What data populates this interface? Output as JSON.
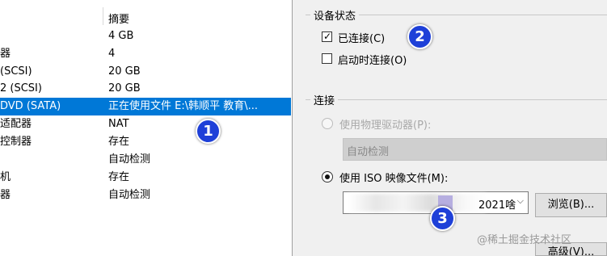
{
  "device_list": {
    "summary_header": "摘要",
    "rows": [
      {
        "device": "",
        "summary": "4 GB"
      },
      {
        "device": "器",
        "summary": "4"
      },
      {
        "device": " (SCSI)",
        "summary": "20 GB"
      },
      {
        "device": "2 (SCSI)",
        "summary": "20 GB"
      },
      {
        "device": "DVD (SATA)",
        "summary": "正在使用文件 E:\\韩顺平 教育\\..."
      },
      {
        "device": "适配器",
        "summary": "NAT"
      },
      {
        "device": "控制器",
        "summary": "存在"
      },
      {
        "device": "",
        "summary": "自动检测"
      },
      {
        "device": "机",
        "summary": "存在"
      },
      {
        "device": "器",
        "summary": "自动检测"
      }
    ],
    "selected_index": 4
  },
  "device_status": {
    "title": "设备状态",
    "connected_label": "已连接(C)",
    "connected_checked": true,
    "connect_at_power_on_label": "启动时连接(O)",
    "connect_at_power_on_checked": false
  },
  "connection": {
    "title": "连接",
    "physical_drive_label": "使用物理驱动器(P):",
    "physical_drive_value": "自动检测",
    "iso_label": "使用 ISO 映像文件(M):",
    "iso_value": "2021啥",
    "browse_label": "浏览(B)...",
    "advanced_label": "高级(V)..."
  },
  "annotations": [
    "1",
    "2",
    "3"
  ],
  "watermark": "@稀土掘金技术社区",
  "colors": {
    "selection": "#0078d7",
    "badge": "#1e40d8"
  }
}
